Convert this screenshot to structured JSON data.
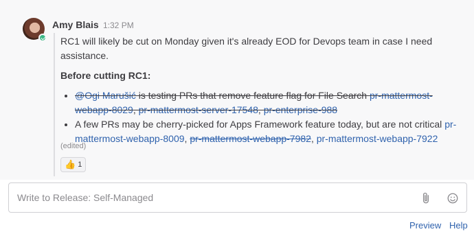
{
  "post": {
    "author": "Amy Blais",
    "time": "1:32 PM",
    "paragraph": "RC1 will likely be cut on Monday given it's already EOD for Devops team in case I need assistance.",
    "heading": "Before cutting RC1:",
    "items": [
      {
        "mention": "@Ogi Marušić",
        "text": " is testing PRs that remove feature flag for File Search ",
        "link1": "pr-mattermost-webapp-8029",
        "link2": "pr-mattermost-server-17548",
        "link3": "pr-enterprise-988"
      },
      {
        "text": "A few PRs may be cherry-picked for Apps Framework feature today, but are not critical ",
        "link1": "pr-mattermost-webapp-8009",
        "link2": "pr-mattermost-webapp-7982",
        "link3": "pr-mattermost-webapp-7922"
      }
    ],
    "edited": "(edited)",
    "reaction": {
      "emoji": "👍",
      "count": "1"
    }
  },
  "composer": {
    "placeholder": "Write to Release: Self-Managed"
  },
  "footer": {
    "preview": "Preview",
    "help": "Help"
  },
  "colors": {
    "link": "#2f62ad",
    "online": "#3db887"
  }
}
